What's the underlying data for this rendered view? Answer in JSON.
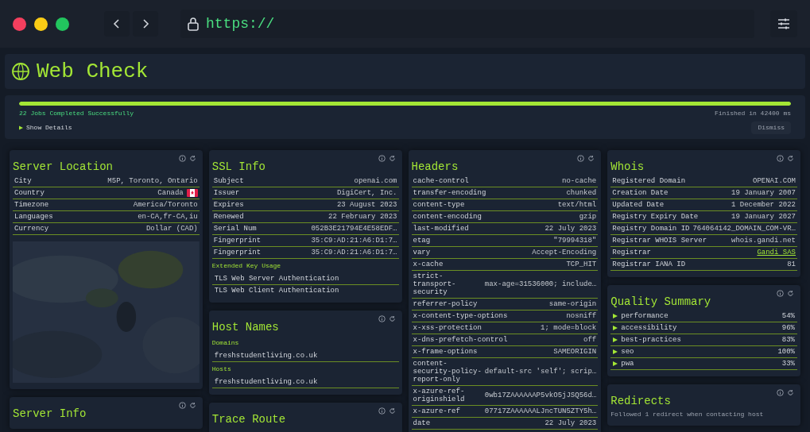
{
  "browser": {
    "url": "https://"
  },
  "header": {
    "title": "Web Check"
  },
  "progress": {
    "level": 1,
    "status": "22 Jobs Completed Successfully",
    "time": "Finished in 42400 ms",
    "details": "Show Details",
    "dismiss": "Dismiss"
  },
  "columns": [
    {
      "cards": [
        {
          "title": "Server Location",
          "blocks": [
            {
              "kind": "rows",
              "rows": [
                {
                  "label": "City",
                  "value": "M5P, Toronto, Ontario"
                },
                {
                  "label": "Country",
                  "value": "Canada",
                  "flag": true
                },
                {
                  "label": "Timezone",
                  "value": "America/Toronto"
                },
                {
                  "label": "Languages",
                  "value": "en-CA,fr-CA,iu"
                },
                {
                  "label": "Currency",
                  "value": "Dollar (CAD)"
                }
              ]
            },
            {
              "kind": "map"
            }
          ]
        },
        {
          "title": "Server Info"
        }
      ]
    },
    {
      "cards": [
        {
          "title": "SSL Info",
          "blocks": [
            {
              "kind": "rows",
              "rows": [
                {
                  "label": "Subject",
                  "value": "openai.com"
                },
                {
                  "label": "Issuer",
                  "value": "DigiCert, Inc."
                },
                {
                  "label": "Expires",
                  "value": "23 August 2023"
                },
                {
                  "label": "Renewed",
                  "value": "22 February 2023"
                },
                {
                  "label": "Serial Num",
                  "value": "052B3E21794E4E58EDF…"
                },
                {
                  "label": "Fingerprint",
                  "value": "35:C9:AD:21:A6:D1:7…"
                },
                {
                  "label": "Fingerprint",
                  "value": "35:C9:AD:21:A6:D1:7…"
                }
              ]
            },
            {
              "kind": "heading",
              "text": "Extended Key Usage"
            },
            {
              "kind": "list",
              "items": [
                "TLS Web Server Authentication",
                "TLS Web Client Authentication"
              ]
            }
          ]
        },
        {
          "title": "Host Names",
          "blocks": [
            {
              "kind": "heading",
              "text": "Domains"
            },
            {
              "kind": "list",
              "items": [
                "freshstudentliving.co.uk"
              ]
            },
            {
              "kind": "heading",
              "text": "Hosts"
            },
            {
              "kind": "list",
              "items": [
                "freshstudentliving.co.uk"
              ]
            }
          ]
        },
        {
          "title": "Trace Route"
        }
      ]
    },
    {
      "cards": [
        {
          "title": "Headers",
          "blocks": [
            {
              "kind": "rows",
              "rows": [
                {
                  "label": "cache-control",
                  "value": "no-cache"
                },
                {
                  "label": "transfer-encoding",
                  "value": "chunked"
                },
                {
                  "label": "content-type",
                  "value": "text/html"
                },
                {
                  "label": "content-encoding",
                  "value": "gzip"
                },
                {
                  "label": "last-modified",
                  "value": "22 July 2023"
                },
                {
                  "label": "etag",
                  "value": "\"79994318\""
                },
                {
                  "label": "vary",
                  "value": "Accept-Encoding"
                },
                {
                  "label": "x-cache",
                  "value": "TCP_HIT"
                },
                {
                  "label": "strict-transport-security",
                  "value": "max-age=31536000; include…"
                },
                {
                  "label": "referrer-policy",
                  "value": "same-origin"
                },
                {
                  "label": "x-content-type-options",
                  "value": "nosniff"
                },
                {
                  "label": "x-xss-protection",
                  "value": "1; mode=block"
                },
                {
                  "label": "x-dns-prefetch-control",
                  "value": "off"
                },
                {
                  "label": "x-frame-options",
                  "value": "SAMEORIGIN"
                },
                {
                  "label": "content-security-policy-report-only",
                  "value": "default-src 'self'; scrip…"
                },
                {
                  "label": "x-azure-ref-originshield",
                  "value": "0wb17ZAAAAAAP5vkO5jJSQ56d…"
                },
                {
                  "label": "x-azure-ref",
                  "value": "07717ZAAAAAALJncTUN5ZTY5h…"
                },
                {
                  "label": "date",
                  "value": "22 July 2023"
                }
              ]
            }
          ]
        }
      ]
    },
    {
      "cards": [
        {
          "title": "Whois",
          "blocks": [
            {
              "kind": "rows",
              "rows": [
                {
                  "label": "Registered Domain",
                  "value": "OPENAI.COM"
                },
                {
                  "label": "Creation Date",
                  "value": "19 January 2007"
                },
                {
                  "label": "Updated Date",
                  "value": "1 December 2022"
                },
                {
                  "label": "Registry Expiry Date",
                  "value": "19 January 2027"
                },
                {
                  "label": "Registry Domain ID",
                  "value": "764064142_DOMAIN_COM-VR…"
                },
                {
                  "label": "Registrar WHOIS Server",
                  "value": "whois.gandi.net"
                },
                {
                  "label": "Registrar",
                  "value": "Gandi SAS",
                  "link": true
                },
                {
                  "label": "Registrar IANA ID",
                  "value": "81"
                }
              ]
            }
          ]
        },
        {
          "title": "Quality Summary",
          "blocks": [
            {
              "kind": "scores",
              "items": [
                {
                  "label": "performance",
                  "value": "54%",
                  "expanded": false
                },
                {
                  "label": "accessibility",
                  "value": "96%",
                  "expanded": false
                },
                {
                  "label": "best-practices",
                  "value": "83%",
                  "expanded": false
                },
                {
                  "label": "seo",
                  "value": "100%",
                  "expanded": false
                },
                {
                  "label": "pwa",
                  "value": "33%",
                  "expanded": false
                }
              ]
            }
          ]
        },
        {
          "title": "Redirects",
          "blocks": [
            {
              "kind": "note",
              "text": "Followed 1 redirect when contacting host"
            }
          ]
        }
      ]
    }
  ]
}
